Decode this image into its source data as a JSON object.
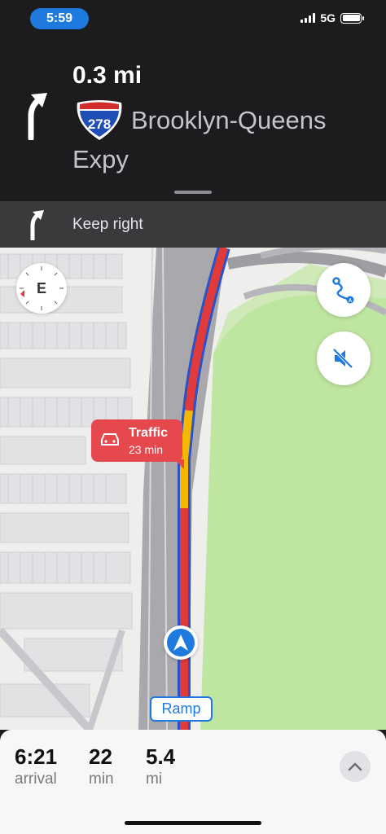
{
  "status_bar": {
    "time": "5:59",
    "network": "5G",
    "accent_color": "#1f7ae0"
  },
  "guidance": {
    "distance": "0.3 mi",
    "maneuver_icon": "bear-left-arrow-icon",
    "route_shield": {
      "number": "278",
      "icon": "interstate-shield-icon"
    },
    "road_name": "Brooklyn-Queens Expy"
  },
  "next_instruction": {
    "icon": "bear-left-arrow-icon",
    "text": "Keep right"
  },
  "map": {
    "compass_heading": "E",
    "route_button_icon": "route-overview-icon",
    "mute_button_icon": "speaker-muted-icon",
    "traffic_alert": {
      "title": "Traffic",
      "time": "23 min",
      "color": "#e5484d"
    },
    "road_label": "Ramp",
    "route_colors": {
      "heavy": "#e03a3a",
      "moderate": "#f5b800",
      "outline": "#2a52c9"
    }
  },
  "trip": {
    "arrival_value": "6:21",
    "arrival_label": "arrival",
    "duration_value": "22",
    "duration_label": "min",
    "distance_value": "5.4",
    "distance_label": "mi",
    "expand_icon": "chevron-up-icon"
  }
}
